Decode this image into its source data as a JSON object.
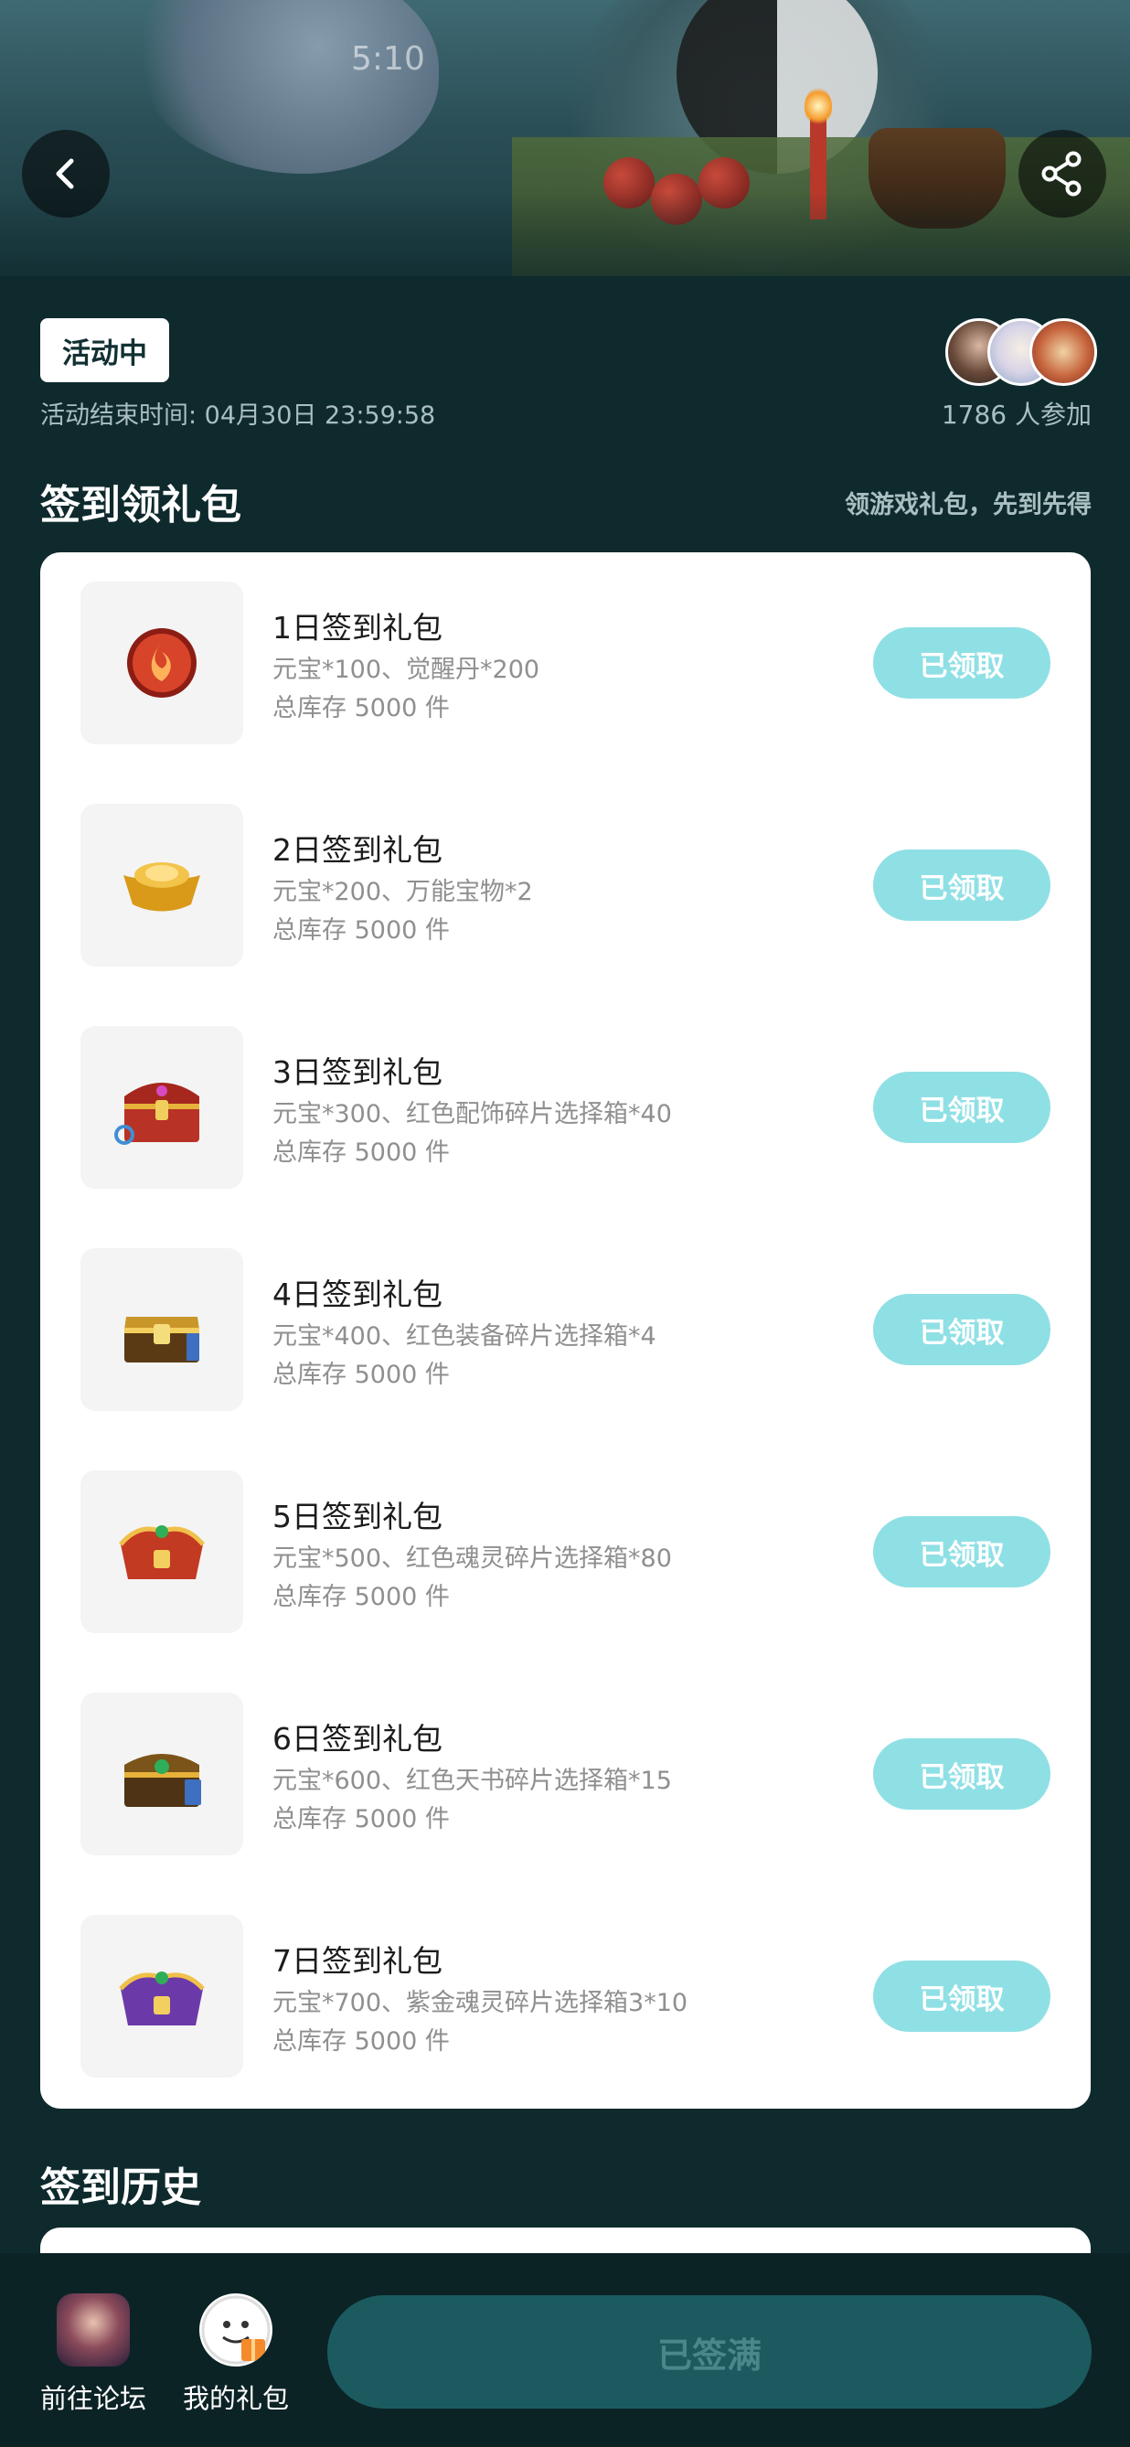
{
  "status_bar": {
    "time": "5:10"
  },
  "header": {
    "back_icon": "chevron-left-icon",
    "share_icon": "share-icon"
  },
  "activity": {
    "badge": "活动中",
    "end_time": "活动结束时间: 04月30日 23:59:58",
    "participants": "1786 人参加"
  },
  "gift_section": {
    "title": "签到领礼包",
    "hint": "领游戏礼包，先到先得",
    "packs": [
      {
        "title": "1日签到礼包",
        "items": "元宝*100、觉醒丹*200",
        "stock": "总库存 5000 件",
        "button": "已领取",
        "icon": "fire-orb-icon"
      },
      {
        "title": "2日签到礼包",
        "items": "元宝*200、万能宝物*2",
        "stock": "总库存 5000 件",
        "button": "已领取",
        "icon": "gold-ingot-icon"
      },
      {
        "title": "3日签到礼包",
        "items": "元宝*300、红色配饰碎片选择箱*40",
        "stock": "总库存 5000 件",
        "button": "已领取",
        "icon": "treasure-chest-icon"
      },
      {
        "title": "4日签到礼包",
        "items": "元宝*400、红色装备碎片选择箱*4",
        "stock": "总库存 5000 件",
        "button": "已领取",
        "icon": "treasure-chest-icon"
      },
      {
        "title": "5日签到礼包",
        "items": "元宝*500、红色魂灵碎片选择箱*80",
        "stock": "总库存 5000 件",
        "button": "已领取",
        "icon": "treasure-chest-icon"
      },
      {
        "title": "6日签到礼包",
        "items": "元宝*600、红色天书碎片选择箱*15",
        "stock": "总库存 5000 件",
        "button": "已领取",
        "icon": "treasure-chest-icon"
      },
      {
        "title": "7日签到礼包",
        "items": "元宝*700、紫金魂灵碎片选择箱3*10",
        "stock": "总库存 5000 件",
        "button": "已领取",
        "icon": "treasure-chest-icon"
      }
    ]
  },
  "history_section": {
    "title": "签到历史"
  },
  "bottom_bar": {
    "forum_label": "前往论坛",
    "gifts_label": "我的礼包",
    "main_button": "已签满"
  },
  "colors": {
    "background": "#0f2a2d",
    "claim_button": "#8fe0e5",
    "main_button": "#1b5b5f"
  }
}
